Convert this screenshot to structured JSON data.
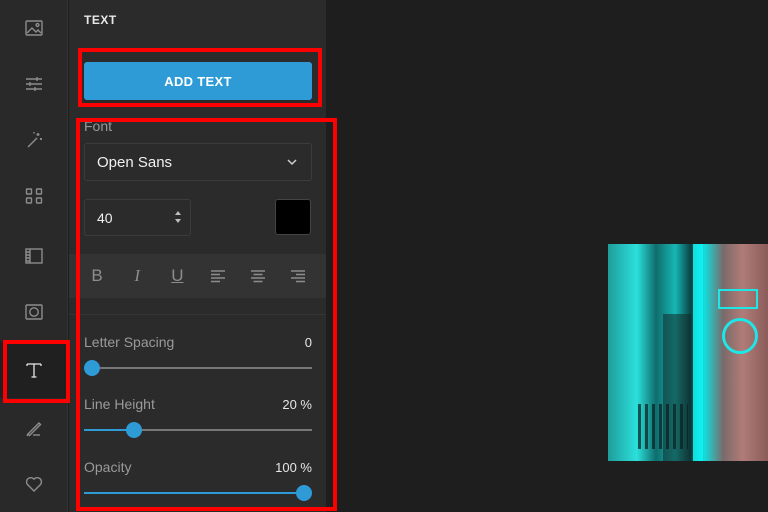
{
  "rail": {
    "items": [
      {
        "icon": "image-icon"
      },
      {
        "icon": "sliders-icon"
      },
      {
        "icon": "magic-wand-icon"
      },
      {
        "icon": "grid-icon"
      },
      {
        "icon": "frame-icon"
      },
      {
        "icon": "vignette-icon"
      },
      {
        "icon": "text-icon",
        "active": true
      },
      {
        "icon": "brush-icon"
      },
      {
        "icon": "heart-icon"
      }
    ]
  },
  "panel": {
    "title": "TEXT",
    "add_text_label": "ADD TEXT",
    "font_label": "Font",
    "font_value": "Open Sans",
    "size_value": "40",
    "color_value": "#000000",
    "format_buttons": [
      {
        "icon": "bold-icon",
        "glyph": "B"
      },
      {
        "icon": "italic-icon",
        "glyph": "I"
      },
      {
        "icon": "underline-icon",
        "glyph": "U"
      },
      {
        "icon": "align-left-icon"
      },
      {
        "icon": "align-center-icon"
      },
      {
        "icon": "align-right-icon"
      }
    ],
    "letter_spacing": {
      "label": "Letter Spacing",
      "value": "0",
      "fraction": 0.0
    },
    "line_height": {
      "label": "Line Height",
      "value": "20 %",
      "fraction": 0.2
    },
    "opacity": {
      "label": "Opacity",
      "value": "100 %",
      "fraction": 1.0
    }
  },
  "colors": {
    "accent": "#2e9bd6",
    "highlight": "#ff0000"
  }
}
